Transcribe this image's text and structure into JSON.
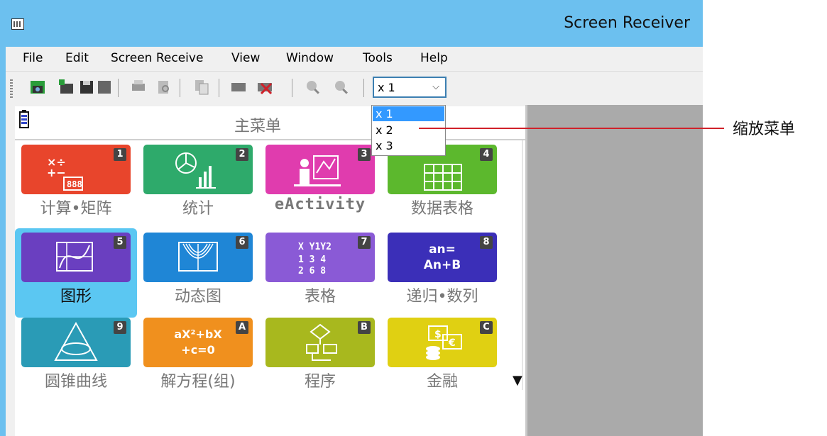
{
  "window": {
    "title": "Screen Receiver"
  },
  "menubar": {
    "items": [
      "File",
      "Edit",
      "Screen Receive",
      "View",
      "Window",
      "Tools",
      "Help"
    ]
  },
  "toolbar": {
    "buttons": [
      "capture-icon",
      "new-icon",
      "save-icon",
      "print-icon",
      "print-preview-icon",
      "copy-icon",
      "connect-icon",
      "disconnect-icon",
      "zoom-in-icon",
      "zoom-out-icon"
    ],
    "zoom_value": "x 1"
  },
  "zoom_dropdown": {
    "options": [
      "x 1",
      "x 2",
      "x 3"
    ],
    "selected": "x 1"
  },
  "calculator": {
    "title": "主菜单",
    "tiles": [
      {
        "num": "1",
        "label": "计算•矩阵",
        "color": "#e8452c",
        "icon": "calculation-matrix-icon"
      },
      {
        "num": "2",
        "label": "统计",
        "color": "#2eaa6b",
        "icon": "statistics-icon"
      },
      {
        "num": "3",
        "label": "eActivity",
        "color": "#e03cae",
        "icon": "eactivity-icon"
      },
      {
        "num": "4",
        "label": "数据表格",
        "color": "#5cb82d",
        "icon": "spreadsheet-icon"
      },
      {
        "num": "5",
        "label": "图形",
        "color": "#6a3fc0",
        "icon": "graph-icon"
      },
      {
        "num": "6",
        "label": "动态图",
        "color": "#1f86d6",
        "icon": "dynamic-graph-icon"
      },
      {
        "num": "7",
        "label": "表格",
        "color": "#8a5ad6",
        "icon": "table-icon"
      },
      {
        "num": "8",
        "label": "递归•数列",
        "color": "#3b2fb8",
        "icon": "recursion-icon"
      },
      {
        "num": "9",
        "label": "圆锥曲线",
        "color": "#2a9bb6",
        "icon": "conic-icon"
      },
      {
        "num": "A",
        "label": "解方程(组)",
        "color": "#f0901e",
        "icon": "equation-icon"
      },
      {
        "num": "B",
        "label": "程序",
        "color": "#a8b81e",
        "icon": "program-icon"
      },
      {
        "num": "C",
        "label": "金融",
        "color": "#e0d012",
        "icon": "finance-icon"
      }
    ],
    "art": {
      "t8a": "an=",
      "t8b": "An+B",
      "tAa": "aX²+bX",
      "tAb": "+c=0",
      "t7a": "X Y1Y2",
      "t7b": "1 3 4",
      "t7c": "2 6 8"
    },
    "selected_tile": "5"
  },
  "callout": {
    "text": "缩放菜单",
    "color": "#d0212a"
  }
}
